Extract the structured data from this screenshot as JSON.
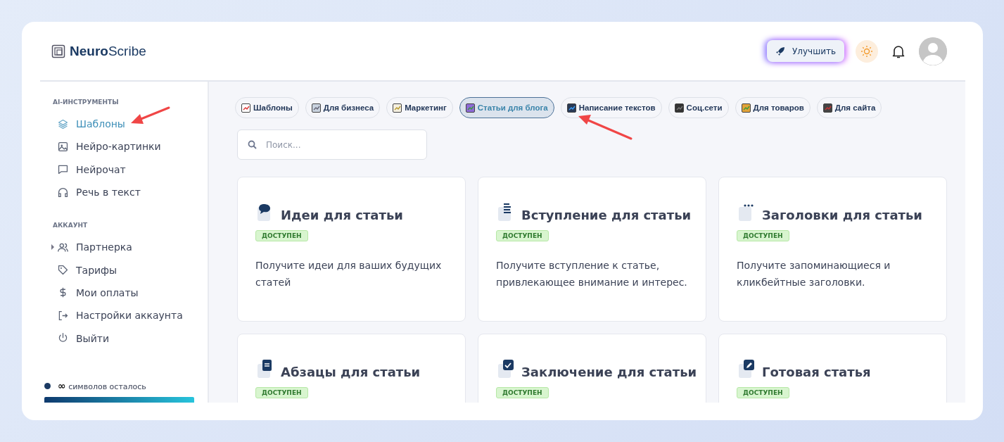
{
  "header": {
    "logo_bold": "Neuro",
    "logo_light": "Scribe",
    "upgrade_button": "Улучшить"
  },
  "sidebar": {
    "sections": [
      {
        "title": "AI-ИНСТРУМЕНТЫ",
        "items": [
          {
            "label": "Шаблоны",
            "kind": "item",
            "selected": true
          },
          {
            "label": "Нейро-картинки",
            "kind": "item",
            "selected": false
          },
          {
            "label": "Нейрочат",
            "kind": "item",
            "selected": false
          },
          {
            "label": "Речь в текст",
            "kind": "item",
            "selected": false
          }
        ]
      },
      {
        "title": "АККАУНТ",
        "items": [
          {
            "label": "Партнерка",
            "kind": "expandable",
            "expanded": false,
            "selected": false
          },
          {
            "label": "Тарифы",
            "kind": "item",
            "selected": false
          },
          {
            "label": "Мои оплаты",
            "kind": "item",
            "selected": false
          },
          {
            "label": "Настройки аккаунта",
            "kind": "item",
            "selected": false
          },
          {
            "label": "Выйти",
            "kind": "item",
            "selected": false
          }
        ]
      }
    ],
    "quota": {
      "symbol": "∞",
      "text": "символов осталось",
      "level": 1
    }
  },
  "categories": [
    {
      "label": "Шаблоны",
      "selected": false
    },
    {
      "label": "Для бизнеса",
      "selected": false
    },
    {
      "label": "Маркетинг",
      "selected": false
    },
    {
      "label": "Статьи для блога",
      "selected": true
    },
    {
      "label": "Написание текстов",
      "selected": false
    },
    {
      "label": "Соц.сети",
      "selected": false
    },
    {
      "label": "Для товаров",
      "selected": false
    },
    {
      "label": "Для сайта",
      "selected": false
    }
  ],
  "search": {
    "placeholder": "Поиск..."
  },
  "cards": [
    {
      "title": "Идеи для статьи",
      "badge": "ДОСТУПЕН",
      "description": "Получите идеи для ваших будущих статей"
    },
    {
      "title": "Вступление для статьи",
      "badge": "ДОСТУПЕН",
      "description": "Получите вступление к статье, привлекающее внимание и интерес."
    },
    {
      "title": "Заголовки для статьи",
      "badge": "ДОСТУПЕН",
      "description": "Получите запоминающиеся и кликбейтные заголовки."
    },
    {
      "title": "Абзацы для статьи",
      "badge": "ДОСТУПЕН"
    },
    {
      "title": "Заключение для статьи",
      "badge": "ДОСТУПЕН"
    },
    {
      "title": "Готовая статья",
      "badge": "ДОСТУПЕН"
    }
  ]
}
